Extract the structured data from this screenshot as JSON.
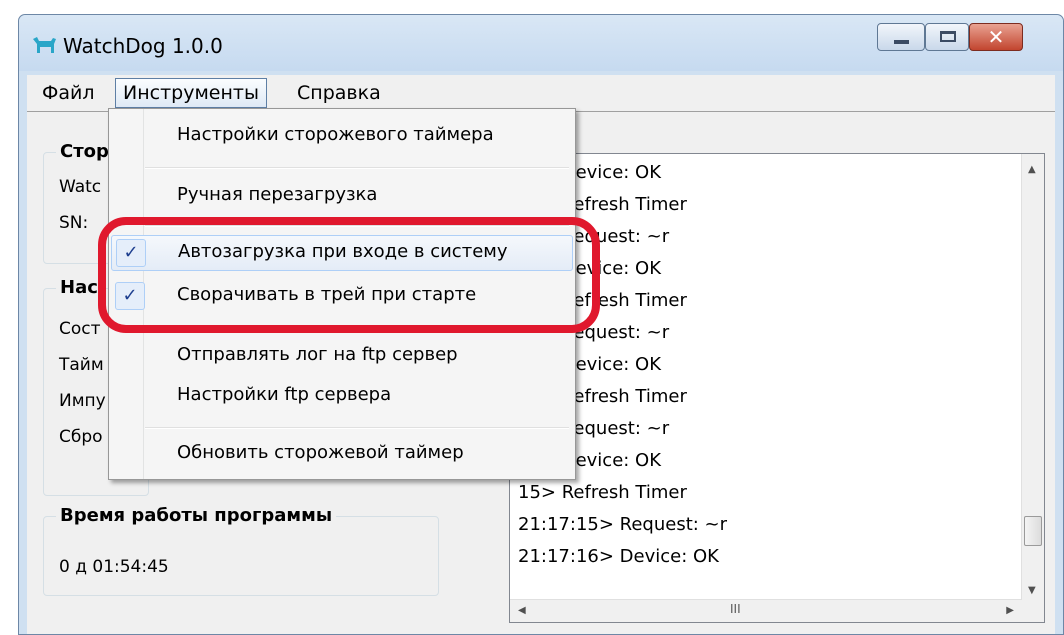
{
  "window": {
    "title": "WatchDog 1.0.0"
  },
  "menubar": {
    "file": "Файл",
    "tools": "Инструменты",
    "help": "Справка"
  },
  "groups": {
    "device": {
      "title": "Стор",
      "rows": [
        "Watc",
        "SN:"
      ]
    },
    "settings": {
      "title": "Нас",
      "rows": [
        "Сост",
        "Тайм",
        "Импу",
        "Сбро"
      ]
    },
    "uptime": {
      "title": "Время работы программы",
      "value": "0 д  01:54:45"
    }
  },
  "log": {
    "lines": [
      "16> Device: OK",
      "15> Refresh Timer",
      "15> Request: ~r",
      "16> Device: OK",
      "15> Refresh Timer",
      "15> Request: ~r",
      "16> Device: OK",
      "15> Refresh Timer",
      "15> Request: ~r",
      "16> Device: OK",
      "15> Refresh Timer",
      "21:17:15> Request: ~r",
      "21:17:16> Device: OK"
    ],
    "hscroll_grip": "III"
  },
  "tools_menu": {
    "items": [
      {
        "label": "Настройки сторожевого таймера",
        "checked": false
      },
      {
        "label": "Ручная перезагрузка",
        "checked": false
      },
      {
        "label": "Автозагрузка при входе в систему",
        "checked": true
      },
      {
        "label": "Сворачивать в трей при старте",
        "checked": true
      },
      {
        "label": "Отправлять лог на ftp сервер",
        "checked": false
      },
      {
        "label": "Настройки ftp сервера",
        "checked": false
      },
      {
        "label": "Обновить сторожевой таймер",
        "checked": false
      }
    ],
    "check_glyph": "✓"
  },
  "colors": {
    "highlight_ring": "#e0182d",
    "title_bar": "#cfe0f1"
  }
}
